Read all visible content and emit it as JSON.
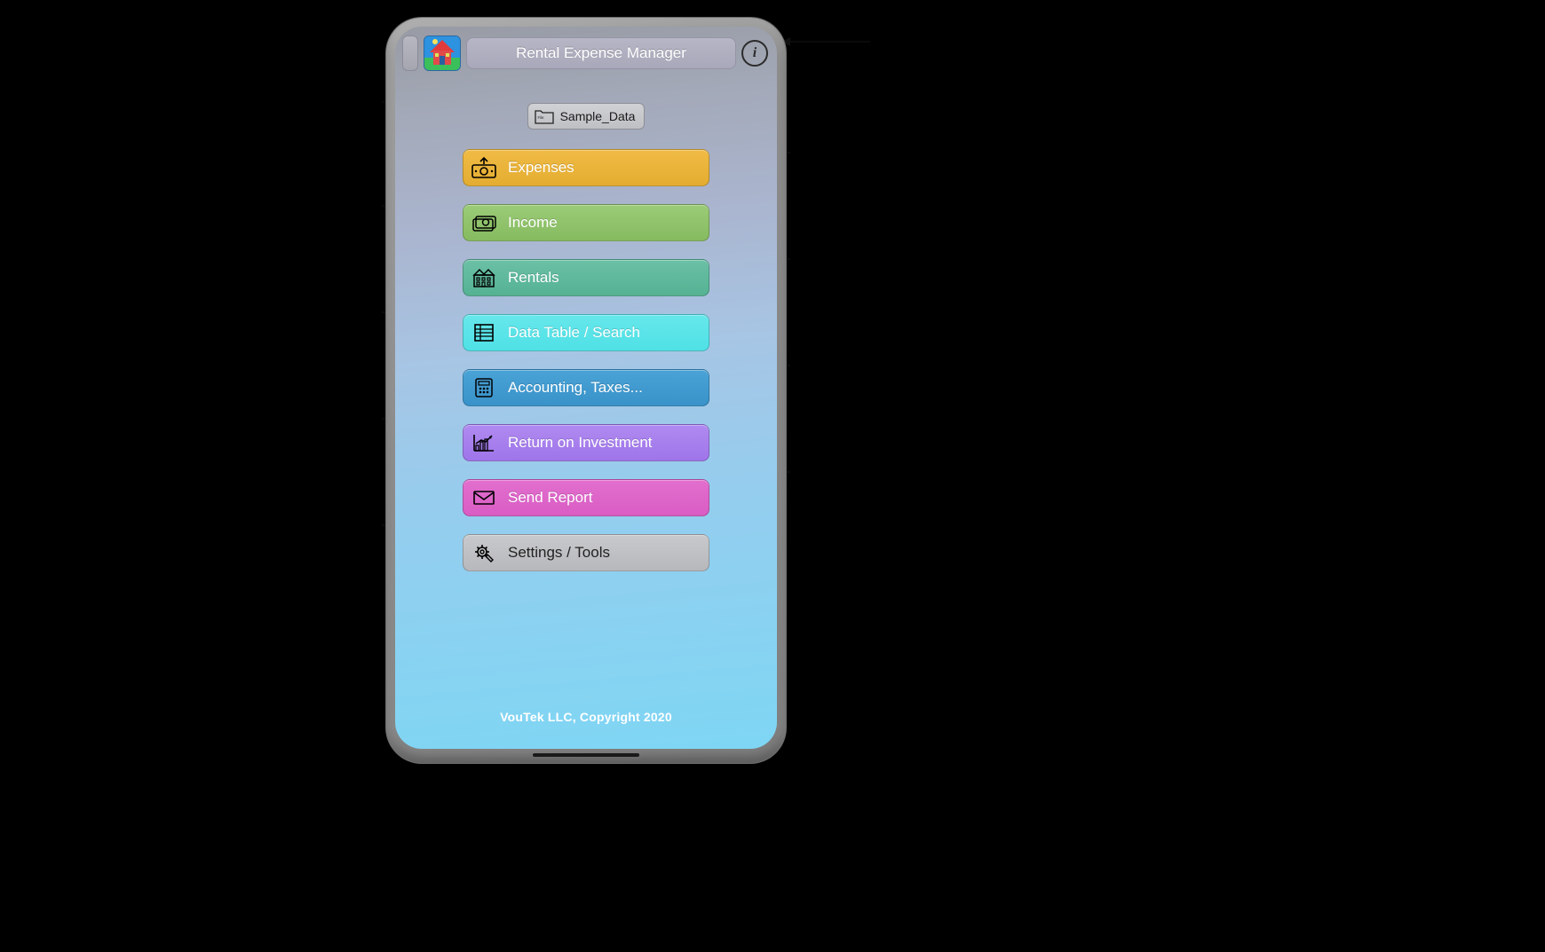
{
  "header": {
    "title": "Rental Expense Manager"
  },
  "file": {
    "label": "Sample_Data",
    "folder_tag": "File:"
  },
  "menu": {
    "expenses": "Expenses",
    "income": "Income",
    "rentals": "Rentals",
    "data_table": "Data Table / Search",
    "accounting": "Accounting, Taxes...",
    "roi": "Return on Investment",
    "report": "Send Report",
    "settings": "Settings / Tools"
  },
  "footer": {
    "copyright": "VouTek LLC, Copyright 2020"
  },
  "info_glyph": "i"
}
